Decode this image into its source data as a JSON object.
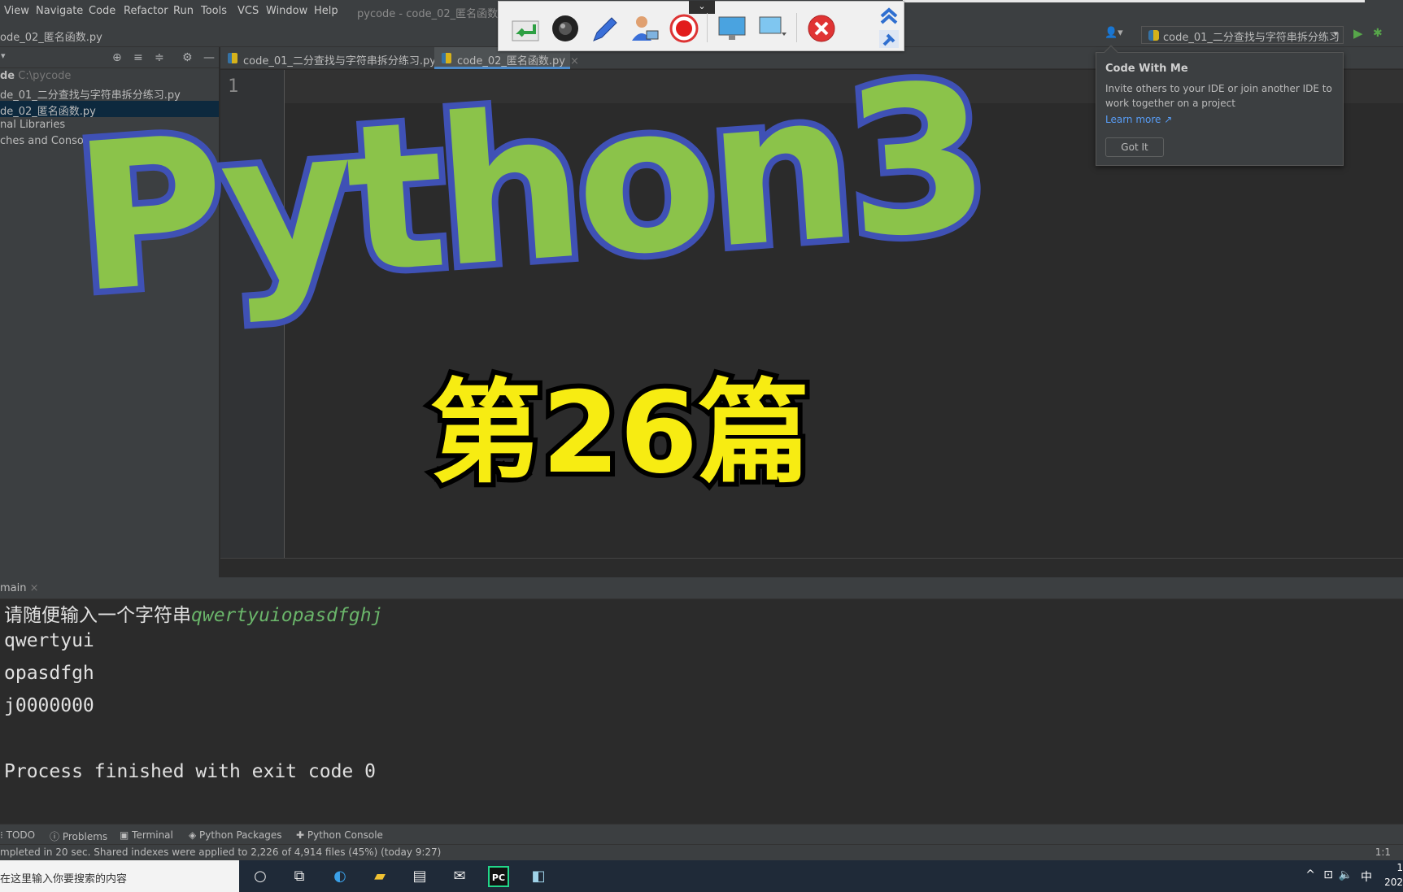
{
  "menu": {
    "items": [
      "View",
      "Navigate",
      "Code",
      "Refactor",
      "Run",
      "Tools",
      "VCS",
      "Window",
      "Help"
    ],
    "window_title": "pycode - code_02_匿名函数.py"
  },
  "breadcrumb": "ode_02_匿名函数.py",
  "run_config": {
    "label": "code_01_二分查找与字符串拆分练习",
    "dropdown": "▾"
  },
  "project": {
    "root_name": "de",
    "root_path": "C:\\pycode",
    "items": [
      "de_01_二分查找与字符串拆分练习.py",
      "de_02_匿名函数.py",
      "nal Libraries",
      "ches and Consoles"
    ],
    "selected_index": 1
  },
  "editor": {
    "tabs": [
      {
        "label": "code_01_二分查找与字符串拆分练习.py",
        "close": "×"
      },
      {
        "label": "code_02_匿名函数.py",
        "close": "×"
      }
    ],
    "active_tab": 1,
    "line_number": "1"
  },
  "overlay": {
    "title": "Python3",
    "episode": "第26篇"
  },
  "run_panel": {
    "tab_label": "main",
    "close": "×"
  },
  "console": {
    "prompt": "请随便输入一个字符串",
    "input": "qwertyuiopasdfghj",
    "lines": [
      "qwertyui",
      "opasdfgh",
      "j0000000"
    ],
    "exit": "Process finished with exit code 0"
  },
  "bottom_tabs": [
    "TODO",
    "Problems",
    "Terminal",
    "Python Packages",
    "Python Console"
  ],
  "status": {
    "message": "mpleted in 20 sec. Shared indexes were applied to 2,226 of 4,914 files (45%) (today 9:27)",
    "position": "1:1"
  },
  "taskbar": {
    "search_placeholder": "在这里输入你要搜索的内容",
    "tray_ime": "中",
    "clock_time": "1",
    "clock_date": "202"
  },
  "popup": {
    "title": "Code With Me",
    "body": "Invite others to your IDE or join another IDE to work together on a project",
    "link": "Learn more ↗",
    "button": "Got It"
  },
  "colors": {
    "accent": "#4a88c7",
    "title_fill": "#8bc34a",
    "title_stroke": "#3f51b5",
    "episode_fill": "#f7ec12",
    "console_input": "#6ab56a"
  }
}
